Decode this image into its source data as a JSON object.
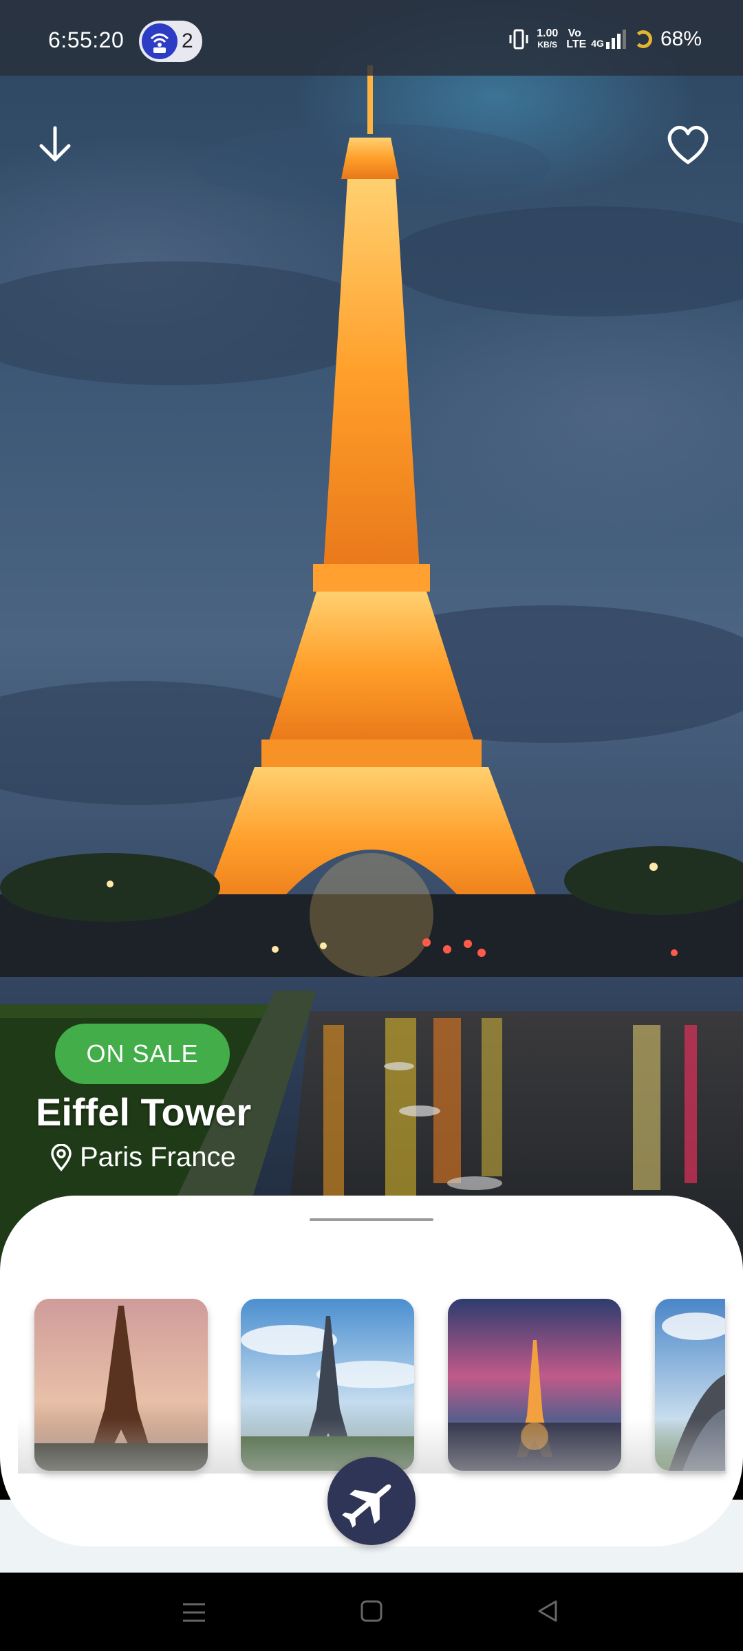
{
  "status_bar": {
    "time": "6:55:20",
    "hotspot_count": "2",
    "net_speed": "1.00",
    "net_unit": "KB/S",
    "volte": "Vo LTE",
    "network": "4G",
    "battery": "68%"
  },
  "hero": {
    "badge": "ON SALE",
    "title": "Eiffel Tower",
    "location": "Paris France"
  },
  "colors": {
    "badge_green": "#43ad4a",
    "fab_navy": "#2f3556",
    "sheet_bg": "#ffffff"
  },
  "icons": [
    "download-arrow-icon",
    "heart-icon",
    "location-pin-icon",
    "airplane-icon",
    "menu-icon",
    "home-square-icon",
    "back-triangle-icon"
  ]
}
